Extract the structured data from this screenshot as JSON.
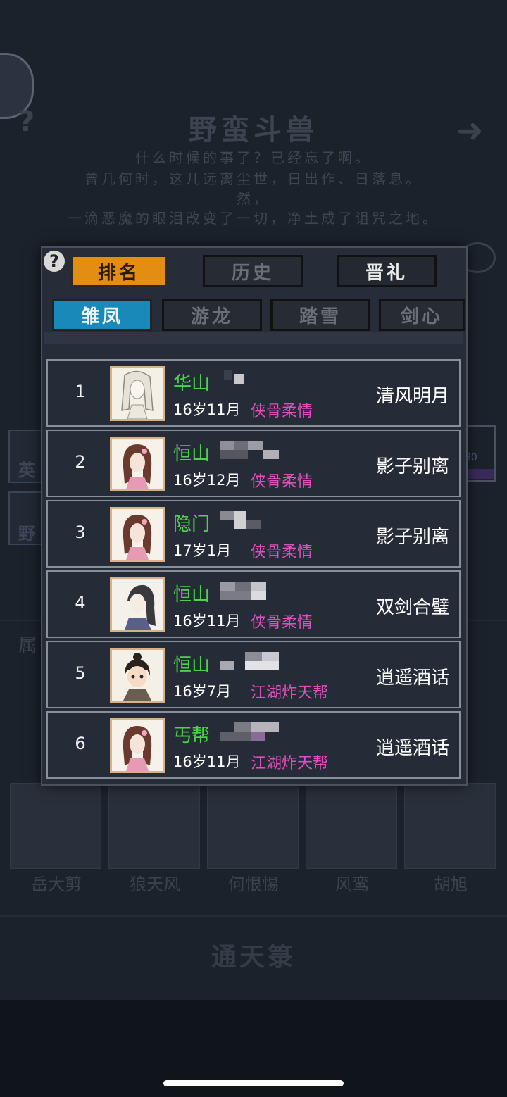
{
  "background": {
    "help_glyph": "?",
    "arrow_glyph": "➜",
    "title": "野蛮斗兽",
    "story_lines": [
      "什么时候的事了？已经忘了啊。",
      "曾几何时，这儿远离尘世，日出作、日落息。",
      "然，",
      "一滴恶魔的眼泪改变了一切，净土成了诅咒之地。"
    ],
    "side_labels": [
      "英",
      "野"
    ],
    "side_number": "80",
    "attr_label": "属",
    "characters": [
      "岳大剪",
      "狼天风",
      "何恨惕",
      "风鸾",
      "胡旭"
    ],
    "bottom_title": "通天箓"
  },
  "dialog": {
    "help_label": "?",
    "top_tabs": [
      {
        "label": "排名",
        "state": "active"
      },
      {
        "label": "历史",
        "state": "inactive"
      },
      {
        "label": "晋礼",
        "state": "light"
      }
    ],
    "sub_tabs": [
      {
        "label": "雏凤",
        "state": "active"
      },
      {
        "label": "游龙",
        "state": "inactive"
      },
      {
        "label": "踏雪",
        "state": "inactive"
      },
      {
        "label": "剑心",
        "state": "inactive"
      }
    ],
    "rankings": [
      {
        "rank": "1",
        "sect": "华山",
        "age": "16岁11月",
        "guild": "侠骨柔情",
        "skill": "清风明月",
        "portrait": "white-haired-swordsman"
      },
      {
        "rank": "2",
        "sect": "恒山",
        "age": "16岁12月",
        "guild": "侠骨柔情",
        "skill": "影子别离",
        "portrait": "heroine-flower-hairpin"
      },
      {
        "rank": "3",
        "sect": "隐门",
        "age": "17岁1月",
        "guild": "侠骨柔情",
        "skill": "影子别离",
        "portrait": "heroine-flower-hairpin"
      },
      {
        "rank": "4",
        "sect": "恒山",
        "age": "16岁11月",
        "guild": "侠骨柔情",
        "skill": "双剑合璧",
        "portrait": "long-haired-swordsman"
      },
      {
        "rank": "5",
        "sect": "恒山",
        "age": "16岁7月",
        "guild": "江湖炸天帮",
        "skill": "逍遥酒话",
        "portrait": "young-boy-topknot"
      },
      {
        "rank": "6",
        "sect": "丐帮",
        "age": "16岁11月",
        "guild": "江湖炸天帮",
        "skill": "逍遥酒话",
        "portrait": "heroine-flower-hairpin"
      }
    ]
  }
}
